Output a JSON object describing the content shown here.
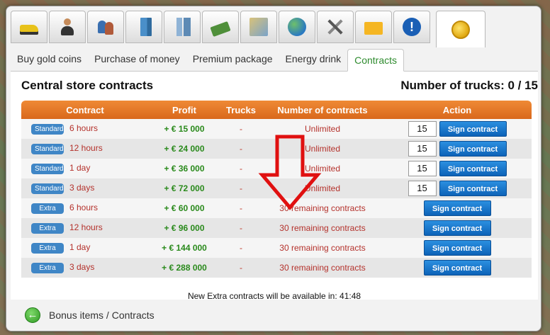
{
  "icon_tabs": [
    {
      "icon": "bulldozer-icon"
    },
    {
      "icon": "businessman-icon"
    },
    {
      "icon": "employees-icon"
    },
    {
      "icon": "building-icon"
    },
    {
      "icon": "towers-icon"
    },
    {
      "icon": "money-icon"
    },
    {
      "icon": "map-icon"
    },
    {
      "icon": "globe-icon"
    },
    {
      "icon": "tools-icon"
    },
    {
      "icon": "mail-icon"
    },
    {
      "icon": "info-icon",
      "glyph": "!"
    },
    {
      "icon": "gold-coin-icon",
      "active": true
    }
  ],
  "text_tabs": [
    {
      "label": "Buy gold coins"
    },
    {
      "label": "Purchase of money"
    },
    {
      "label": "Premium package"
    },
    {
      "label": "Energy drink"
    },
    {
      "label": "Contracts",
      "active": true
    }
  ],
  "main": {
    "title": "Central store contracts",
    "trucks_label": "Number of trucks: 0 / 15"
  },
  "table": {
    "headers": [
      "Contract",
      "Profit",
      "Trucks",
      "Number of contracts",
      "Action"
    ],
    "rows": [
      {
        "type": "Standard",
        "duration": "6 hours",
        "profit": "+ € 15 000",
        "trucks": "-",
        "number": "Unlimited",
        "qty": "15",
        "action": "Sign contract"
      },
      {
        "type": "Standard",
        "duration": "12 hours",
        "profit": "+ € 24 000",
        "trucks": "-",
        "number": "Unlimited",
        "qty": "15",
        "action": "Sign contract"
      },
      {
        "type": "Standard",
        "duration": "1 day",
        "profit": "+ € 36 000",
        "trucks": "-",
        "number": "Unlimited",
        "qty": "15",
        "action": "Sign contract"
      },
      {
        "type": "Standard",
        "duration": "3 days",
        "profit": "+ € 72 000",
        "trucks": "-",
        "number": "Unlimited",
        "qty": "15",
        "action": "Sign contract"
      },
      {
        "type": "Extra",
        "duration": "6 hours",
        "profit": "+ € 60 000",
        "trucks": "-",
        "number": "30 remaining contracts",
        "action": "Sign contract"
      },
      {
        "type": "Extra",
        "duration": "12 hours",
        "profit": "+ € 96 000",
        "trucks": "-",
        "number": "30 remaining contracts",
        "action": "Sign contract"
      },
      {
        "type": "Extra",
        "duration": "1 day",
        "profit": "+ € 144 000",
        "trucks": "-",
        "number": "30 remaining contracts",
        "action": "Sign contract"
      },
      {
        "type": "Extra",
        "duration": "3 days",
        "profit": "+ € 288 000",
        "trucks": "-",
        "number": "30 remaining contracts",
        "action": "Sign contract"
      }
    ]
  },
  "footer_note": "New Extra contracts will be available in: 41:48",
  "breadcrumb": {
    "back_glyph": "←",
    "path": "Bonus items / Contracts"
  },
  "colors": {
    "header_orange": "#e0742a",
    "badge_blue": "#3f86c6",
    "button_blue": "#1a76cf",
    "profit_green": "#2a8a1c",
    "text_red": "#b4312b",
    "active_tab_green": "#2e8b2e",
    "arrow_red": "#e01010"
  }
}
